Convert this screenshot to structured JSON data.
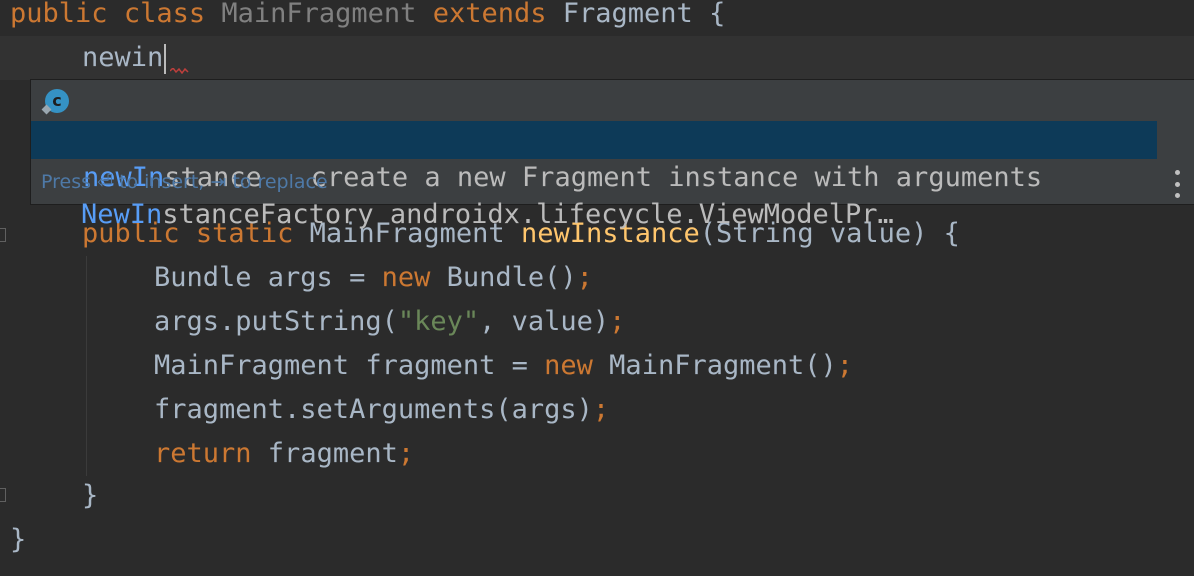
{
  "editor": {
    "line1": {
      "kw_public": "public",
      "kw_class": "class",
      "class_name": "MainFragment",
      "kw_extends": "extends",
      "parent": "Fragment",
      "brace": "{"
    },
    "typed_text": "newin",
    "method_sig": {
      "kw_public": "public",
      "kw_static": "static",
      "return_type": "MainFragment",
      "name": "newInstance",
      "params": "(String value) {"
    },
    "body": {
      "l1_a": "Bundle args = ",
      "l1_kw": "new",
      "l1_b": " Bundle()",
      "l1_semi": ";",
      "l2_a": "args.putString(",
      "l2_str": "\"key\"",
      "l2_b": ", value)",
      "l2_semi": ";",
      "l3_a": "MainFragment fragment = ",
      "l3_kw": "new",
      "l3_b": " MainFragment()",
      "l3_semi": ";",
      "l4_a": "fragment.setArguments(args)",
      "l4_semi": ";",
      "l5_kw": "return",
      "l5_b": " fragment",
      "l5_semi": ";"
    },
    "method_close": "}",
    "class_close": "}"
  },
  "completion": {
    "items": [
      {
        "icon": "class-icon",
        "icon_letter": "c",
        "match": "NewIn",
        "rest": "stanceFactory",
        "detail": "androidx.lifecycle.ViewModelPr…"
      },
      {
        "match": "newIn",
        "rest": "stance",
        "detail": "create a new Fragment instance with arguments"
      }
    ],
    "hint": "Press ⏎ to insert, ⇥ to replace",
    "more_icon": "kebab-menu-icon"
  },
  "colors": {
    "background": "#2b2b2b",
    "keyword": "#cc7832",
    "function": "#ffc66d",
    "string": "#6a8759",
    "selection": "#0d3a58",
    "match": "#589df6"
  }
}
